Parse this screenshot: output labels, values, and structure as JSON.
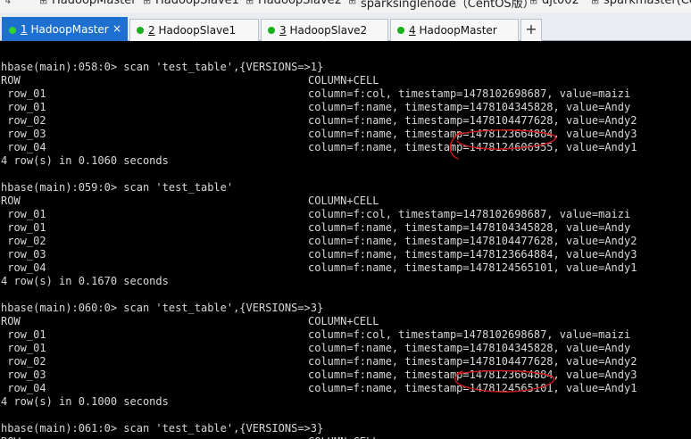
{
  "bookmarks": [
    "HadoopMaster",
    "HadoopSlave1",
    "HadoopSlave2",
    "sparksinglenode（CentOS版）",
    "djt002",
    "sparkmaster(Cen"
  ],
  "tabs": [
    {
      "num": "1",
      "name": "HadoopMaster",
      "active": true
    },
    {
      "num": "2",
      "name": "HadoopSlave1",
      "active": false
    },
    {
      "num": "3",
      "name": "HadoopSlave2",
      "active": false
    },
    {
      "num": "4",
      "name": "HadoopMaster",
      "active": false
    }
  ],
  "tab_close": "×",
  "add_tab": "+",
  "colors": {
    "tab_active": "#1d6fd0",
    "status_dot": "#1ab01a",
    "annotation": "#d11a1a"
  },
  "terminal": {
    "lines": [
      {
        "a": "hbase(main):058:0> scan 'test_table',{VERSIONS=>1}",
        "b": ""
      },
      {
        "a": "ROW",
        "b": "COLUMN+CELL"
      },
      {
        "a": " row_01",
        "b": "column=f:col, timestamp=1478102698687, value=maizi"
      },
      {
        "a": " row_01",
        "b": "column=f:name, timestamp=1478104345828, value=Andy"
      },
      {
        "a": " row_02",
        "b": "column=f:name, timestamp=1478104477628, value=Andy2"
      },
      {
        "a": " row_03",
        "b": "column=f:name, timestamp=1478123664884, value=Andy3"
      },
      {
        "a": " row_04",
        "b": "column=f:name, timestamp=1478124606955, value=Andy1"
      },
      {
        "a": "4 row(s) in 0.1060 seconds",
        "b": ""
      },
      {
        "a": "",
        "b": ""
      },
      {
        "a": "hbase(main):059:0> scan 'test_table'",
        "b": ""
      },
      {
        "a": "ROW",
        "b": "COLUMN+CELL"
      },
      {
        "a": " row_01",
        "b": "column=f:col, timestamp=1478102698687, value=maizi"
      },
      {
        "a": " row_01",
        "b": "column=f:name, timestamp=1478104345828, value=Andy"
      },
      {
        "a": " row_02",
        "b": "column=f:name, timestamp=1478104477628, value=Andy2"
      },
      {
        "a": " row_03",
        "b": "column=f:name, timestamp=1478123664884, value=Andy3"
      },
      {
        "a": " row_04",
        "b": "column=f:name, timestamp=1478124565101, value=Andy1"
      },
      {
        "a": "4 row(s) in 0.1670 seconds",
        "b": ""
      },
      {
        "a": "",
        "b": ""
      },
      {
        "a": "hbase(main):060:0> scan 'test_table',{VERSIONS=>3}",
        "b": ""
      },
      {
        "a": "ROW",
        "b": "COLUMN+CELL"
      },
      {
        "a": " row_01",
        "b": "column=f:col, timestamp=1478102698687, value=maizi"
      },
      {
        "a": " row_01",
        "b": "column=f:name, timestamp=1478104345828, value=Andy"
      },
      {
        "a": " row_02",
        "b": "column=f:name, timestamp=1478104477628, value=Andy2"
      },
      {
        "a": " row_03",
        "b": "column=f:name, timestamp=1478123664884, value=Andy3"
      },
      {
        "a": " row_04",
        "b": "column=f:name, timestamp=1478124565101, value=Andy1"
      },
      {
        "a": "4 row(s) in 0.1000 seconds",
        "b": ""
      },
      {
        "a": "",
        "b": ""
      },
      {
        "a": "hbase(main):061:0> scan 'test_table',{VERSIONS=>3}",
        "b": ""
      },
      {
        "a": "ROW",
        "b": "COLUMN+CELL"
      }
    ]
  }
}
